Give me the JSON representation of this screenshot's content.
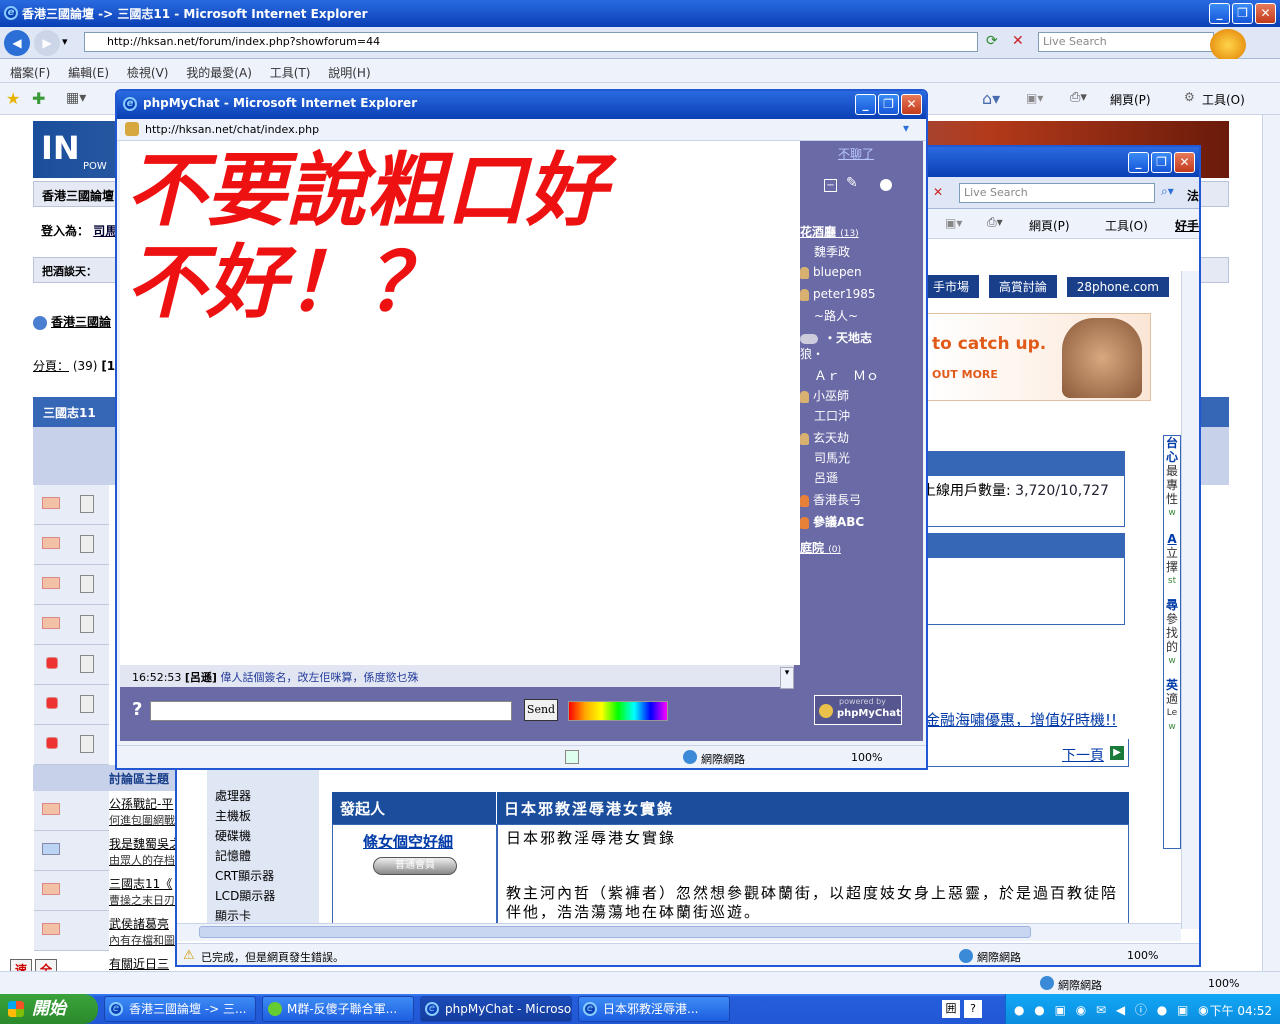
{
  "main_window": {
    "title": "香港三國論壇 -> 三國志11 - Microsoft Internet Explorer",
    "url": "http://hksan.net/forum/index.php?showforum=44",
    "search_placeholder": "Live Search",
    "menu": [
      "檔案(F)",
      "編輯(E)",
      "檢視(V)",
      "我的最愛(A)",
      "工具(T)",
      "說明(H)"
    ],
    "cmd_page": "網頁(P)",
    "cmd_tools": "工具(O)",
    "status_zone": "網際網路",
    "zoom": "100%"
  },
  "forum": {
    "logo_text": "IN",
    "logo_sub": "POW",
    "breadcrumb_site": "香港三國論壇",
    "login_label": "登入為：",
    "login_user": "司馬",
    "drink_label": "把酒談天：",
    "nav_link": "香港三國論",
    "pages_label": "分頁：",
    "pages_count": "(39)",
    "pages_current": "[1]",
    "forum_header": "三國志11",
    "section_label": "討論區主題",
    "topics": [
      {
        "title": "公孫戰記-平",
        "sub": "何進包圍網戰"
      },
      {
        "title": "我是魏蜀吳之",
        "sub": "由眾人的存档"
      },
      {
        "title": "三國志11《",
        "sub": "曹操之末日刃"
      },
      {
        "title": "武侯諸葛亮",
        "sub": "內有存檔和圖"
      },
      {
        "title": "有關近日三",
        "sub": ""
      }
    ],
    "speed_btns": [
      "速",
      "全"
    ]
  },
  "second_window": {
    "search_placeholder": "Live Search",
    "cmd_page": "網頁(P)",
    "cmd_tools": "工具(O)",
    "extra": "好手",
    "extra2": "法",
    "tabs": [
      "手市場",
      "高賞討論",
      "28phone.com"
    ],
    "ad_text": "to catch up.",
    "ad_more": "OUT MORE",
    "online_label": "上線用戶數量:",
    "online_value": "3,720/10,727",
    "promo_link": "金融海嘯優惠，增值好時機!!",
    "next_page": "下一頁",
    "side_links": [
      "處理器",
      "主機板",
      "硬碟機",
      "記憶體",
      "CRT顯示器",
      "LCD顯示器",
      "顯示卡"
    ],
    "post_header_left": "發起人",
    "post_header_right": "日本邪教淫辱港女實錄",
    "poster_name": "條女個空好細",
    "poster_rank": "普通會員",
    "post_title": "日本邪教淫辱港女實錄",
    "post_body": "教主河內哲（紫褲者）忽然想參觀砵蘭街，以超度妓女身上惡靈，於是過百教徒陪伴他，浩浩蕩蕩地在砵蘭街巡遊。",
    "right_col": [
      "台",
      "心",
      "最",
      "專",
      "性",
      "w",
      "A",
      "立",
      "擇",
      "st",
      "尋",
      "參",
      "找",
      "的",
      "w",
      "英",
      "適",
      "Le",
      "w"
    ],
    "status_text": "已完成，但是網頁發生錯誤。",
    "status_zone": "網際網路",
    "zoom": "100%"
  },
  "chat_window": {
    "title": "phpMyChat - Microsoft Internet Explorer",
    "url": "http://hksan.net/chat/index.php",
    "big_message_line1": "不要說粗口好",
    "big_message_line2": "不好！？",
    "quit_label": "不聊了",
    "room_name": "花酒廳",
    "room_count": "(13)",
    "users": [
      "魏季政",
      "bluepen",
      "peter1985",
      "~路人~",
      "・天地志",
      "狼・",
      "Ａｒ　Ｍｏ",
      "小巫師",
      "工口沖",
      "玄天劫",
      "司馬光",
      "呂遜",
      "香港長弓",
      "參議ABC"
    ],
    "room2_name": "庭院",
    "room2_count": "(0)",
    "msg_time": "16:52:53",
    "msg_user": "[呂遜]",
    "msg_text": "偉人話個簽名，改左佢咪算，係度慾乜殊",
    "send_label": "Send",
    "powered_by": "powered by",
    "powered_name": "phpMyChat",
    "status_zone": "網際網路",
    "zoom": "100%"
  },
  "taskbar": {
    "start_label": "開始",
    "tasks": [
      "香港三國論壇 -> 三...",
      "M群-反傻子聯合軍...",
      "phpMyChat - Microso...",
      "日本邪教淫辱港..."
    ],
    "clock": "下午 04:52"
  }
}
